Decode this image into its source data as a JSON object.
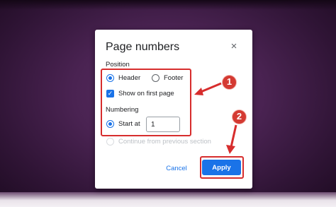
{
  "dialog": {
    "title": "Page numbers",
    "close_glyph": "×",
    "position": {
      "label": "Position",
      "options": [
        {
          "label": "Header",
          "selected": true
        },
        {
          "label": "Footer",
          "selected": false
        }
      ],
      "checkbox": {
        "label": "Show on first page",
        "checked": true
      }
    },
    "numbering": {
      "label": "Numbering",
      "start_at": {
        "label": "Start at",
        "selected": true,
        "value": "1"
      },
      "continue_option": {
        "label": "Continue from previous section",
        "selected": false,
        "disabled": true
      }
    },
    "buttons": {
      "cancel": "Cancel",
      "apply": "Apply"
    }
  },
  "annotations": {
    "badge_1": "1",
    "badge_2": "2",
    "color": "#d72d2d"
  },
  "icons": {
    "close": "close-icon",
    "check": "checkmark-icon"
  },
  "colors": {
    "accent": "#1a73e8",
    "highlight": "#d72d2d",
    "background": "#4a2352"
  }
}
